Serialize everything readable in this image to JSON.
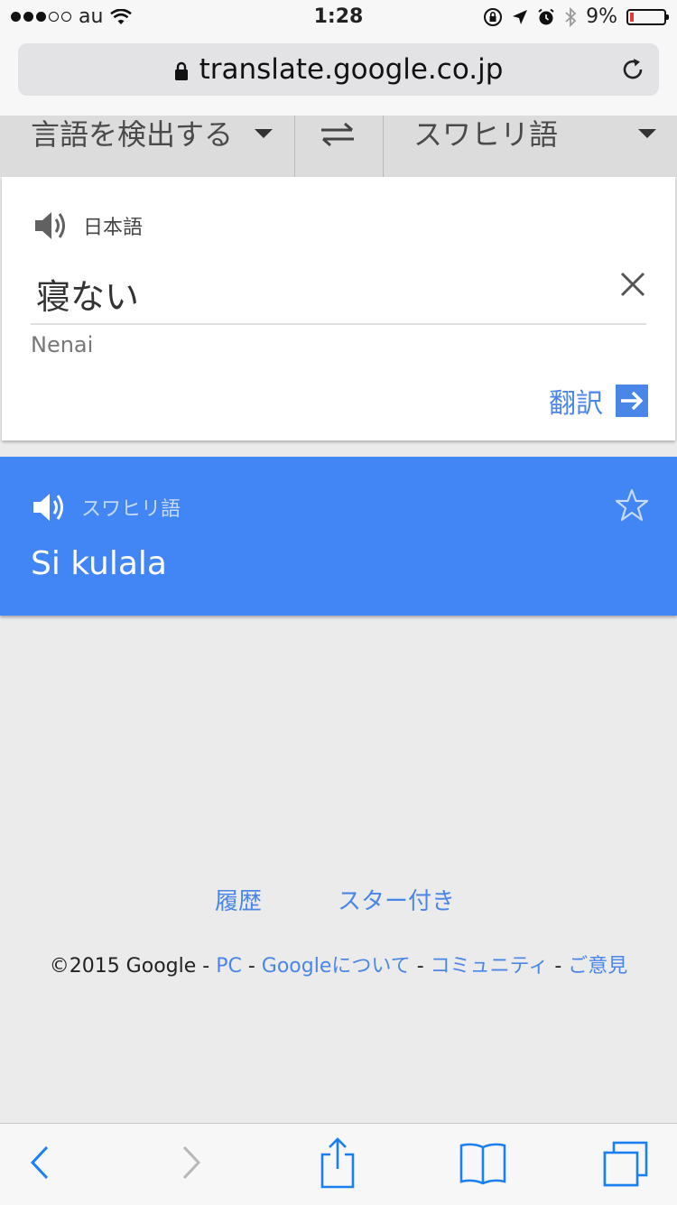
{
  "status_bar": {
    "carrier": "au",
    "time": "1:28",
    "battery_percent": "9%",
    "battery_level": 0.09,
    "signal_bars_filled": 3,
    "signal_bars_total": 5
  },
  "browser": {
    "url": "translate.google.co.jp"
  },
  "language_bar": {
    "source_language": "言語を検出する",
    "target_language": "スワヒリ語"
  },
  "input": {
    "detected_language": "日本語",
    "text": "寝ない",
    "transliteration": "Nenai",
    "translate_button": "翻訳"
  },
  "result": {
    "language": "スワヒリ語",
    "text": "Si kulala"
  },
  "footer": {
    "history_link": "履歴",
    "starred_link": "スター付き",
    "copyright": "©2015 Google",
    "sep": " - ",
    "pc_link": "PC",
    "about_link": "Googleについて",
    "community_link": "コミュニティ",
    "feedback_link": "ご意見"
  },
  "icons": {
    "colors": {
      "accent": "#4285f4",
      "link": "#4a86e8",
      "battery_low": "#e53935"
    }
  }
}
